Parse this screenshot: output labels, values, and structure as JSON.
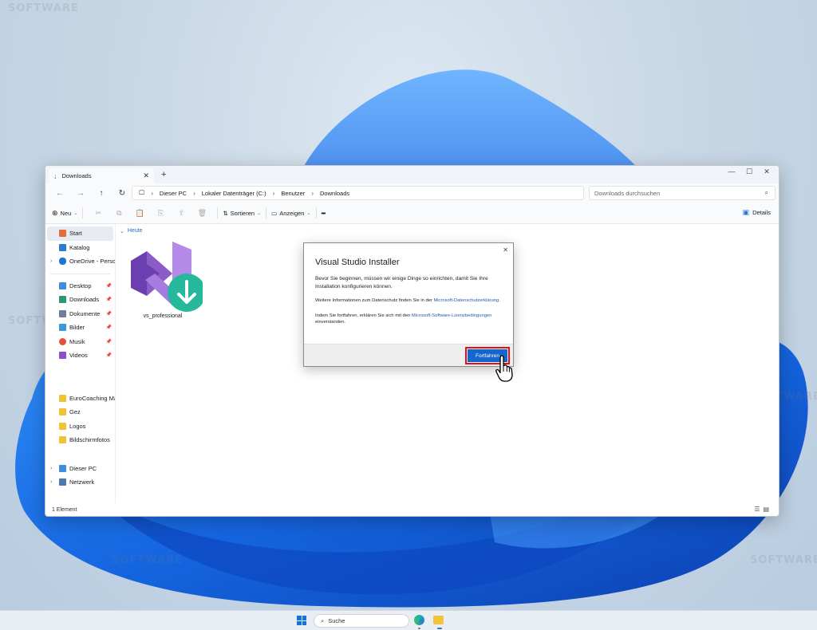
{
  "explorer": {
    "tab_title": "Downloads",
    "breadcrumb": [
      "Dieser PC",
      "Lokaler Datenträger (C:)",
      "Benutzer",
      "Downloads"
    ],
    "search_placeholder": "Downloads durchsuchen",
    "toolbar": {
      "new_label": "Neu",
      "sort_label": "Sortieren",
      "view_label": "Anzeigen",
      "more_label": "•••",
      "details_label": "Details"
    },
    "sidebar": {
      "top": [
        {
          "label": "Start",
          "color": "#e56b3a",
          "active": true
        },
        {
          "label": "Katalog",
          "color": "#2a7bd4"
        },
        {
          "label": "OneDrive - Persona",
          "color": "#1e74d0",
          "expandable": true
        }
      ],
      "pinned": [
        {
          "label": "Desktop",
          "color": "#3b8ee0"
        },
        {
          "label": "Downloads",
          "color": "#2a9a6e"
        },
        {
          "label": "Dokumente",
          "color": "#6d7f99"
        },
        {
          "label": "Bilder",
          "color": "#3a9ad9"
        },
        {
          "label": "Musik",
          "color": "#e0533a"
        },
        {
          "label": "Videos",
          "color": "#8a4fc9"
        }
      ],
      "folders": [
        {
          "label": "EuroCoaching Maste",
          "color": "#f1c232"
        },
        {
          "label": "Gez",
          "color": "#f1c232"
        },
        {
          "label": "Logos",
          "color": "#f1c232"
        },
        {
          "label": "Bildschirmfotos",
          "color": "#f1c232"
        }
      ],
      "bottom": [
        {
          "label": "Dieser PC",
          "color": "#3b8ee0"
        },
        {
          "label": "Netzwerk",
          "color": "#4a7ab5"
        }
      ]
    },
    "group_label": "Heute",
    "file_name": "vs_professional",
    "status_text": "1 Element"
  },
  "dialog": {
    "title": "Visual Studio Installer",
    "intro": "Bevor Sie beginnen, müssen wir einige Dinge so einrichten, damit Sie Ihre Installation konfigurieren können.",
    "privacy_text": "Weitere Informationen zum Datenschutz finden Sie in der ",
    "privacy_link": "Microsoft-Datenschutzerklärung",
    "license_text": "Indem Sie fortfahren, erklären Sie sich mit den ",
    "license_link": "Microsoft-Software-Lizenzbedingungen",
    "license_suffix": " einverstanden.",
    "continue_label": "Fortfahren"
  },
  "taskbar": {
    "search_label": "Suche"
  },
  "watermark_text": "SOFTWARE",
  "colors": {
    "accent": "#1466cc",
    "highlight_outline": "#e0101a",
    "vs_purple": "#8b5cc8",
    "download_badge": "#26b89a"
  }
}
